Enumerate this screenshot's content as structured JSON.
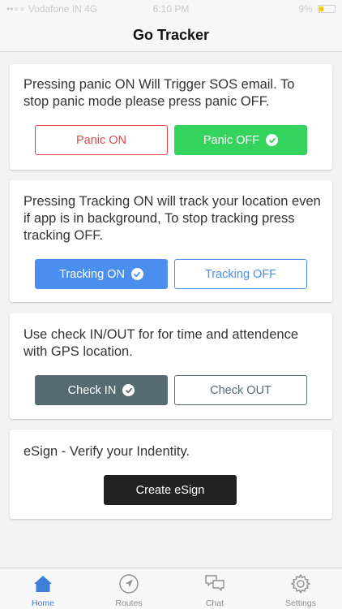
{
  "status_bar": {
    "carrier": "••∘∘ Vodafone IN  4G",
    "time": "6:10 PM",
    "battery": "9% "
  },
  "nav": {
    "title": "Go Tracker"
  },
  "panic_card": {
    "text": "Pressing panic ON Will Trigger SOS email. To stop panic mode please press panic OFF.",
    "on_label": "Panic ON",
    "off_label": "Panic OFF"
  },
  "tracking_card": {
    "text": "Pressing Tracking ON will track your location even if app is in background, To stop tracking press tracking OFF.",
    "on_label": "Tracking ON",
    "off_label": "Tracking OFF"
  },
  "check_card": {
    "text": "Use check IN/OUT for for time and attendence with GPS location.",
    "in_label": "Check IN",
    "out_label": "Check OUT"
  },
  "esign_card": {
    "text": "eSign - Verify your Indentity.",
    "button_label": "Create eSign"
  },
  "tabs": [
    {
      "label": "Home",
      "icon": "home-icon",
      "active": true
    },
    {
      "label": "Routes",
      "icon": "navigation-arrow-icon",
      "active": false
    },
    {
      "label": "Chat",
      "icon": "chat-icon",
      "active": false
    },
    {
      "label": "Settings",
      "icon": "gear-icon",
      "active": false
    }
  ],
  "colors": {
    "panic_on_border": "#e0474c",
    "panic_off_bg": "#33d35d",
    "tracking_on_bg": "#4a8ef0",
    "tracking_off_border": "#4a8ef0",
    "check_in_bg": "#566a72",
    "check_out_border": "#566a72",
    "esign_bg": "#222222",
    "tab_active": "#3d7ed8"
  }
}
